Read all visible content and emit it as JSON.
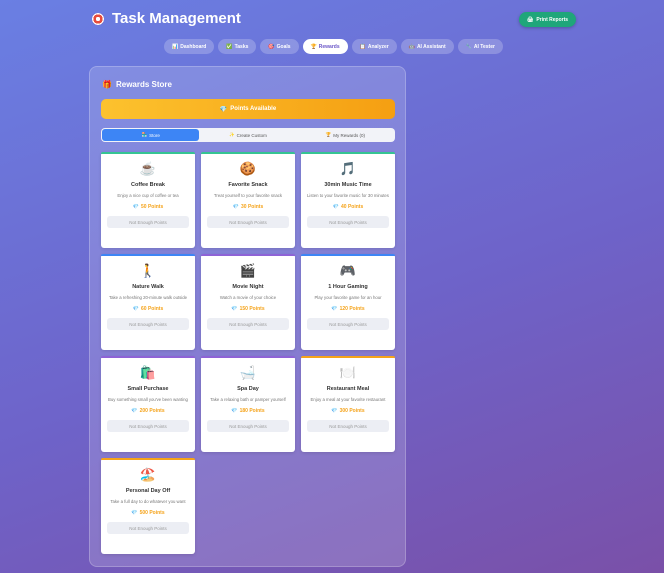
{
  "header": {
    "icon": "target-icon",
    "title": "Task Management"
  },
  "print_button": {
    "label": "Print Reports",
    "icon": "printer-icon"
  },
  "nav": {
    "tabs": [
      {
        "label": "Dashboard",
        "icon": "chart-icon"
      },
      {
        "label": "Tasks",
        "icon": "check-icon"
      },
      {
        "label": "Goals",
        "icon": "target-icon"
      },
      {
        "label": "Rewards",
        "icon": "trophy-icon",
        "active": true
      },
      {
        "label": "Analyzer",
        "icon": "clipboard-icon"
      },
      {
        "label": "AI Assistant",
        "icon": "robot-icon"
      },
      {
        "label": "AI Tester",
        "icon": "wrench-icon"
      }
    ]
  },
  "rewards": {
    "title": "Rewards Store",
    "points_banner": "Points Available",
    "subtabs": [
      {
        "label": "Store",
        "active": true
      },
      {
        "label": "Create Custom"
      },
      {
        "label": "My Rewards (0)"
      }
    ],
    "items": [
      {
        "name": "Coffee Break",
        "emoji": "☕",
        "desc": "Enjoy a nice cup of coffee or tea",
        "points": "50 Points",
        "button": "Not Enough Points",
        "accent": "#35c493"
      },
      {
        "name": "Favorite Snack",
        "emoji": "🍪",
        "desc": "Treat yourself to your favorite snack",
        "points": "30 Points",
        "button": "Not Enough Points",
        "accent": "#35c493"
      },
      {
        "name": "30min Music Time",
        "emoji": "🎵",
        "desc": "Listen to your favorite music for 30 minutes",
        "points": "40 Points",
        "button": "Not Enough Points",
        "accent": "#35c493"
      },
      {
        "name": "Nature Walk",
        "emoji": "🚶",
        "desc": "Take a refreshing 20-minute walk outside",
        "points": "60 Points",
        "button": "Not Enough Points",
        "accent": "#3d85f5"
      },
      {
        "name": "Movie Night",
        "emoji": "🎬",
        "desc": "Watch a movie of your choice",
        "points": "150 Points",
        "button": "Not Enough Points",
        "accent": "#8e63d6"
      },
      {
        "name": "1 Hour Gaming",
        "emoji": "🎮",
        "desc": "Play your favorite game for an hour",
        "points": "120 Points",
        "button": "Not Enough Points",
        "accent": "#3d85f5"
      },
      {
        "name": "Small Purchase",
        "emoji": "🛍️",
        "desc": "Buy something small you've been wanting",
        "points": "200 Points",
        "button": "Not Enough Points",
        "accent": "#8e63d6"
      },
      {
        "name": "Spa Day",
        "emoji": "🛁",
        "desc": "Take a relaxing bath or pamper yourself",
        "points": "180 Points",
        "button": "Not Enough Points",
        "accent": "#8e63d6"
      },
      {
        "name": "Restaurant Meal",
        "emoji": "🍽️",
        "desc": "Enjoy a meal at your favorite restaurant",
        "points": "300 Points",
        "button": "Not Enough Points",
        "accent": "#f5a31a"
      },
      {
        "name": "Personal Day Off",
        "emoji": "🏖️",
        "desc": "Take a full day to do whatever you want",
        "points": "500 Points",
        "button": "Not Enough Points",
        "accent": "#f5a31a"
      }
    ]
  }
}
